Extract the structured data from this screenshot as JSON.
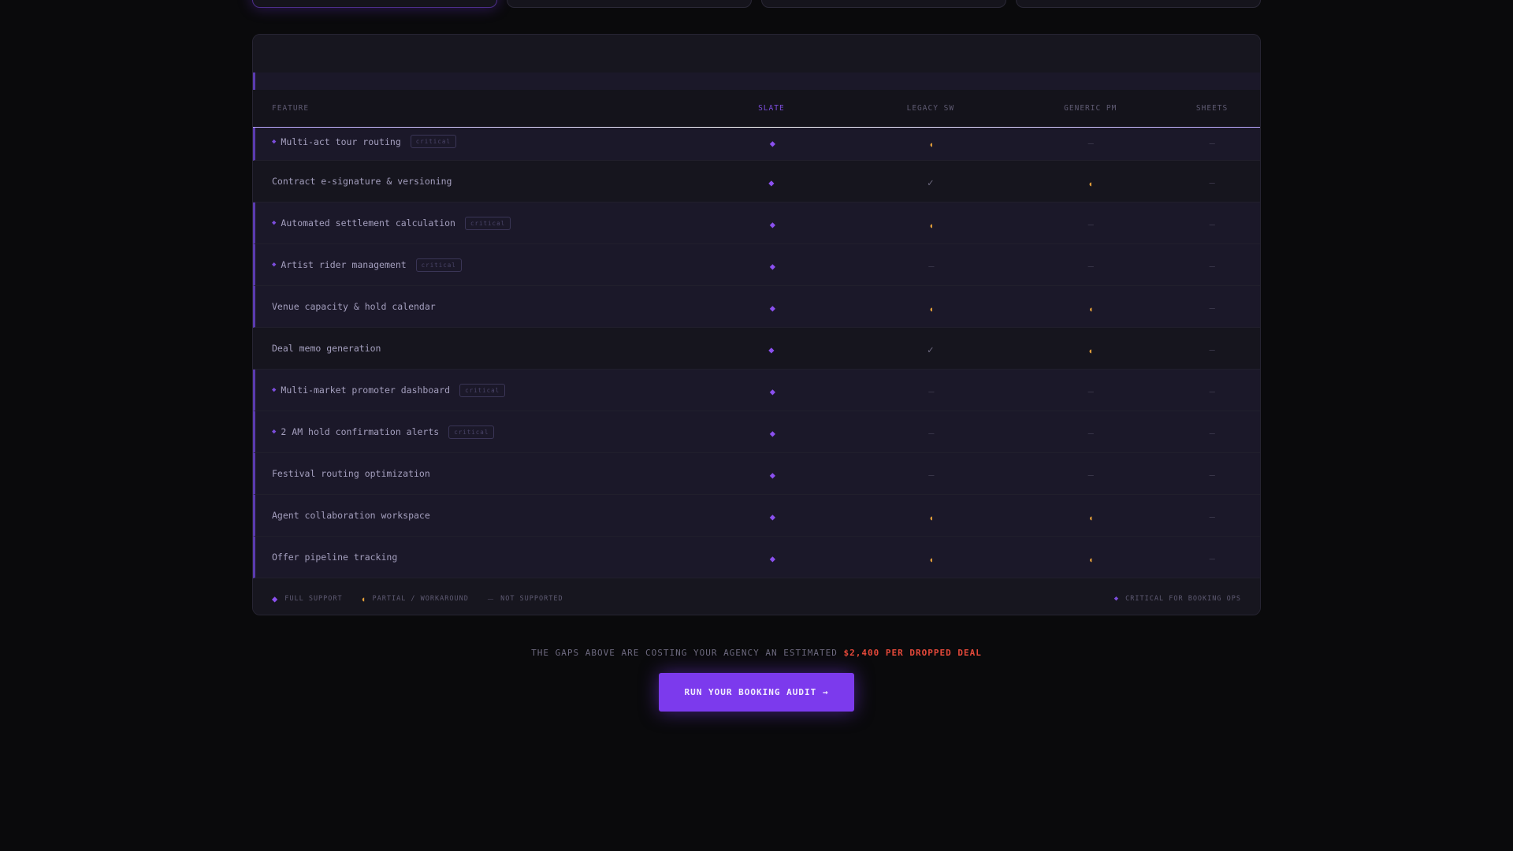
{
  "columns": {
    "feature": "FEATURE",
    "slate": "SLATE",
    "legacy": "LEGACY SW",
    "generic": "GENERIC PM",
    "sheets": "SHEETS"
  },
  "rows": [
    {
      "label": "Multi-act tour routing",
      "critical": true,
      "tag": "critical",
      "slate": "full",
      "legacy": "partial",
      "generic": "none",
      "sheets": "none"
    },
    {
      "label": "Contract e-signature & versioning",
      "critical": false,
      "tag": "",
      "slate": "full",
      "legacy": "check",
      "generic": "partial",
      "sheets": "none"
    },
    {
      "label": "Automated settlement calculation",
      "critical": true,
      "tag": "critical",
      "slate": "full",
      "legacy": "partial",
      "generic": "none",
      "sheets": "none"
    },
    {
      "label": "Artist rider management",
      "critical": true,
      "tag": "critical",
      "slate": "full",
      "legacy": "none",
      "generic": "none",
      "sheets": "none"
    },
    {
      "label": "Venue capacity & hold calendar",
      "critical": false,
      "tag": "",
      "slate": "full",
      "legacy": "partial",
      "generic": "partial",
      "sheets": "none"
    },
    {
      "label": "Deal memo generation",
      "critical": false,
      "tag": "",
      "slate": "full",
      "legacy": "check",
      "generic": "partial",
      "sheets": "none"
    },
    {
      "label": "Multi-market promoter dashboard",
      "critical": true,
      "tag": "critical",
      "slate": "full",
      "legacy": "none",
      "generic": "none",
      "sheets": "none"
    },
    {
      "label": "2 AM hold confirmation alerts",
      "critical": true,
      "tag": "critical",
      "slate": "full",
      "legacy": "none",
      "generic": "none",
      "sheets": "none"
    },
    {
      "label": "Festival routing optimization",
      "critical": false,
      "tag": "",
      "slate": "full",
      "legacy": "none",
      "generic": "none",
      "sheets": "none"
    },
    {
      "label": "Agent collaboration workspace",
      "critical": false,
      "tag": "",
      "slate": "full",
      "legacy": "partial",
      "generic": "partial",
      "sheets": "none"
    },
    {
      "label": "Offer pipeline tracking",
      "critical": false,
      "tag": "",
      "slate": "full",
      "legacy": "partial",
      "generic": "partial",
      "sheets": "none"
    }
  ],
  "legend": {
    "full": "FULL SUPPORT",
    "partial": "PARTIAL / WORKAROUND",
    "none": "NOT SUPPORTED",
    "critical": "CRITICAL FOR BOOKING OPS"
  },
  "symbols": {
    "full": "◆",
    "partial": "◖",
    "none": "—",
    "check": "✓",
    "critical": "◆"
  },
  "cost": {
    "prefix": "THE GAPS ABOVE ARE COSTING YOUR AGENCY AN ESTIMATED",
    "amount": "$2,400 PER DROPPED DEAL"
  },
  "cta": {
    "label": "RUN YOUR BOOKING AUDIT →"
  },
  "colors": {
    "accent": "#7c3aed",
    "partial": "#e6a13a",
    "alert": "#e5493a"
  }
}
